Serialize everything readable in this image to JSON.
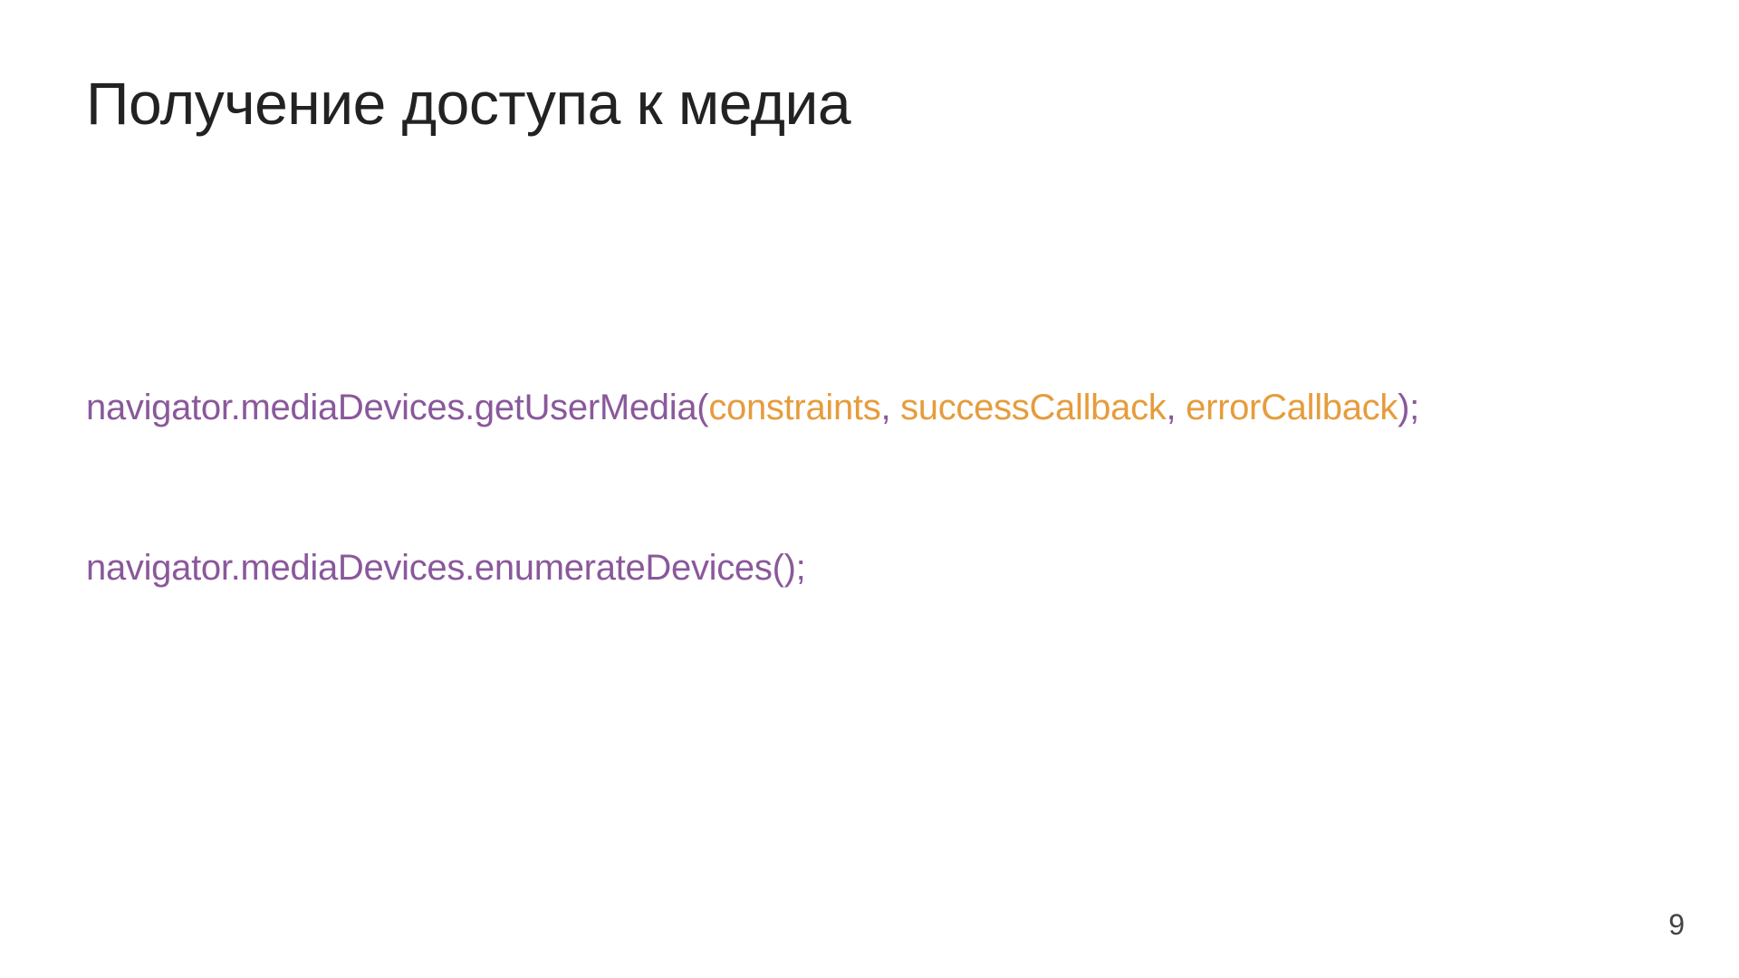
{
  "title": "Получение доступа к медиа",
  "code": {
    "line1": {
      "prefix": "navigator.mediaDevices.getUserMedia(",
      "arg1": "constraints",
      "sep1": ", ",
      "arg2": "successCallback",
      "sep2": ", ",
      "arg3": "errorCallback",
      "suffix": ");"
    },
    "line2": "navigator.mediaDevices.enumerateDevices();"
  },
  "page_number": "9"
}
